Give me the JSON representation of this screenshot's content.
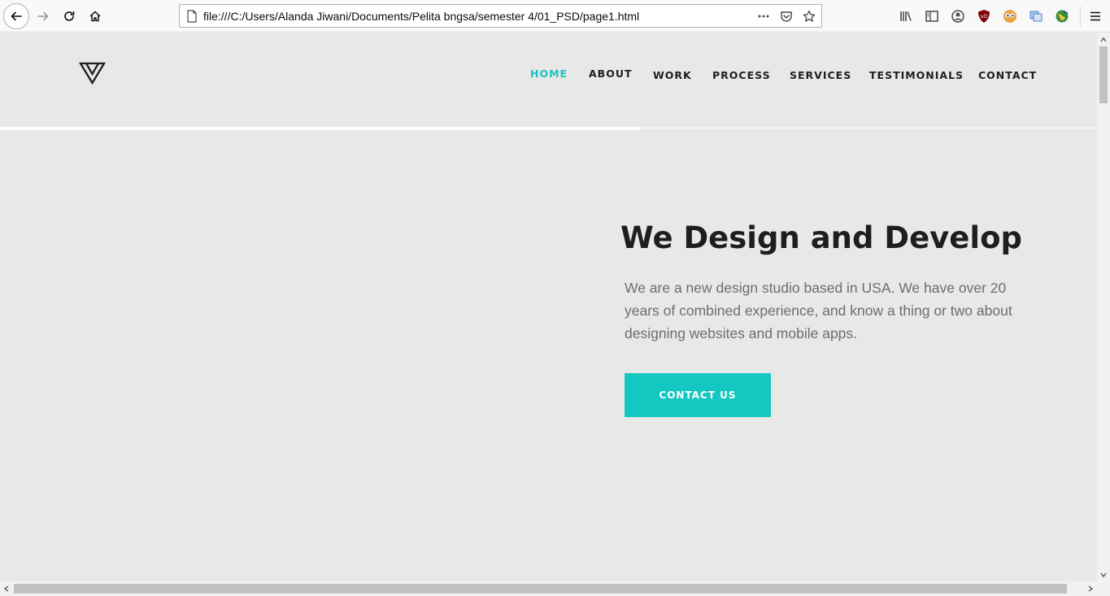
{
  "browser": {
    "url": "file:///C:/Users/Alanda Jiwani/Documents/Pelita bngsa/semester 4/01_PSD/page1.html",
    "url_actions": [
      "more-actions-icon",
      "pocket-icon",
      "bookmark-star-icon"
    ],
    "toolbar_icons": [
      "library-icon",
      "sidebar-icon",
      "account-icon",
      "ublock-icon",
      "extension-eyes-icon",
      "extension-translate-icon",
      "extension-globe-icon",
      "menu-icon"
    ]
  },
  "site": {
    "nav": {
      "home": "HOME",
      "about": "ABOUT",
      "work": "WORK",
      "process": "PROCESS",
      "services": "SERVICES",
      "testimonials": "TESTIMONIALS",
      "contact": "CONTACT"
    },
    "hero": {
      "title": "We Design and Develop",
      "text": "We are a new design studio based in USA. We have over 20 years of combined experience, and know a thing or two about designing websites and mobile apps.",
      "cta": "CONTACT US"
    }
  },
  "colors": {
    "accent": "#19c4c0",
    "button": "#14c8c1",
    "page_bg": "#e8e8e8",
    "heading": "#1e1e1e",
    "body_text": "#6d6d6d"
  }
}
